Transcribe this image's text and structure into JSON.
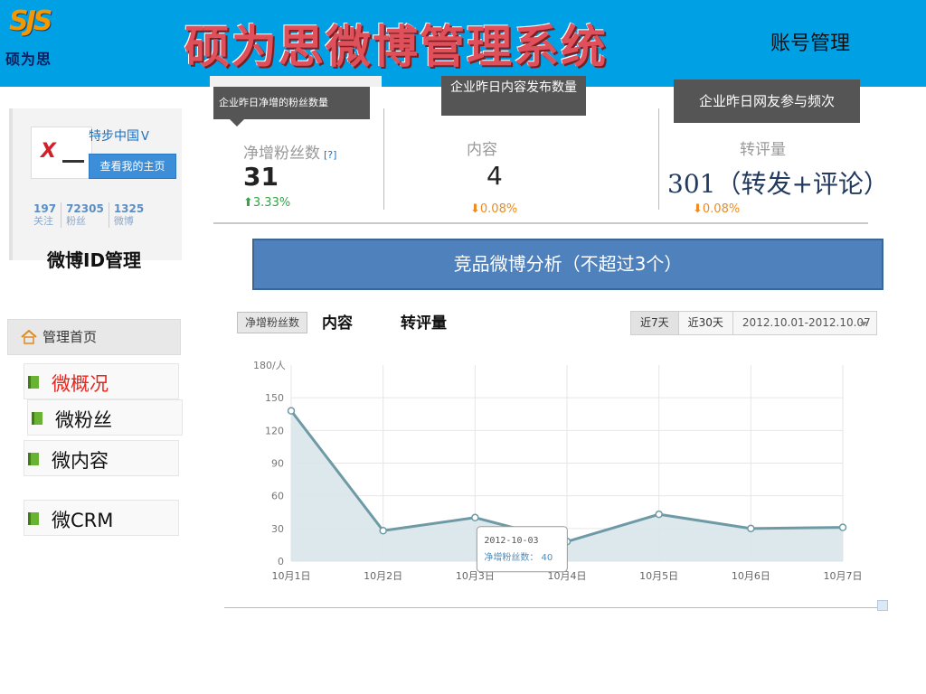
{
  "header": {
    "logo_mark": "SJS",
    "logo_sub": "硕为思",
    "title": "硕为思微博管理系统",
    "account_link": "账号管理"
  },
  "tooltips": {
    "fans": "企业昨日净增的粉丝数量",
    "content": "企业昨日内容发布数量",
    "engagement": "企业昨日网友参与频次"
  },
  "profile": {
    "avatar_text": "X",
    "name": "特步中国",
    "verified_glyph": "V",
    "homepage_button": "查看我的主页",
    "stats": [
      {
        "num": "197",
        "label": "关注"
      },
      {
        "num": "72305",
        "label": "粉丝"
      },
      {
        "num": "1325",
        "label": "微博"
      }
    ],
    "id_manage_label": "微博ID管理"
  },
  "stats": {
    "fans": {
      "label": "净增粉丝数",
      "help": "[?]",
      "value": "31",
      "change": "3.33%"
    },
    "content": {
      "label": "内容",
      "value": "4",
      "change": "0.08%"
    },
    "engagement": {
      "label": "转评量",
      "value": "301（转发+评论）",
      "change": "0.08%"
    }
  },
  "banner": "竞品微博分析（不超过3个）",
  "nav": {
    "home": "管理首页",
    "items": [
      {
        "label": "微概况"
      },
      {
        "label": "微粉丝"
      },
      {
        "label": "微内容"
      },
      {
        "label": "微CRM"
      }
    ]
  },
  "chart_toolbar": {
    "tab_active": "净增粉丝数",
    "tab_2": "内容",
    "tab_3": "转评量",
    "range_7": "近7天",
    "range_30": "近30天",
    "date_range": "2012.10.01-2012.10.07"
  },
  "chart_data": {
    "type": "area",
    "categories": [
      "10月1日",
      "10月2日",
      "10月3日",
      "10月4日",
      "10月5日",
      "10月6日",
      "10月7日"
    ],
    "values": [
      138,
      28,
      40,
      18,
      43,
      30,
      31
    ],
    "ylabel": "180/人",
    "yticks": [
      0,
      30,
      60,
      90,
      120,
      150
    ],
    "ylim": [
      0,
      180
    ],
    "grid": true,
    "tooltip": {
      "date": "2012-10-03",
      "label": "净增粉丝数：",
      "value": "40"
    },
    "colors": {
      "line": "#6e9aa6",
      "fill": "#d9e6ea",
      "grid": "#e6e6e6"
    }
  }
}
